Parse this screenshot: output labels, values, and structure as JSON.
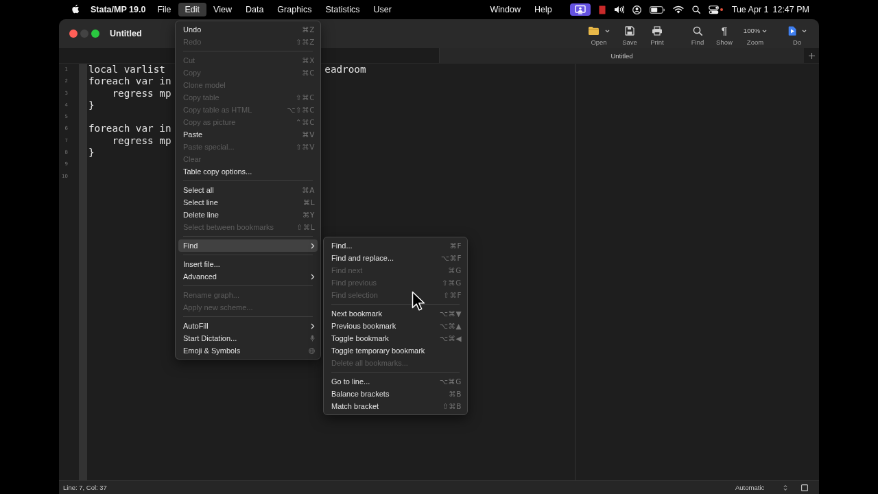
{
  "menu_bar": {
    "app_name": "Stata/MP 19.0",
    "menus": [
      {
        "label": "File",
        "selected": false
      },
      {
        "label": "Edit",
        "selected": true
      },
      {
        "label": "View",
        "selected": false
      },
      {
        "label": "Data",
        "selected": false
      },
      {
        "label": "Graphics",
        "selected": false
      },
      {
        "label": "Statistics",
        "selected": false
      },
      {
        "label": "User",
        "selected": false
      }
    ],
    "right_menus": [
      {
        "label": "Window",
        "selected": false
      },
      {
        "label": "Help",
        "selected": false
      }
    ],
    "date": "Tue Apr 1",
    "time": "12:47 PM"
  },
  "window": {
    "title": "Untitled"
  },
  "toolbar": {
    "tools": [
      {
        "kind": "open",
        "label": "Open",
        "dropdown": true
      },
      {
        "kind": "save",
        "label": "Save",
        "dropdown": false
      },
      {
        "kind": "print",
        "label": "Print",
        "dropdown": false
      },
      {
        "kind": "find",
        "label": "Find",
        "dropdown": false
      },
      {
        "kind": "show",
        "label": "Show",
        "glyph": "¶",
        "dropdown": false
      },
      {
        "kind": "zoom",
        "label": "Zoom",
        "value": "100%",
        "dropdown": true
      },
      {
        "kind": "do",
        "label": "Do",
        "dropdown": true
      }
    ]
  },
  "tabs": [
    {
      "label": "Untitled",
      "selected": true
    }
  ],
  "editor": {
    "lines": [
      {
        "number": "1",
        "parts": [
          "local varlist",
          "eadroom"
        ]
      },
      {
        "number": "2",
        "parts": [
          "foreach var in"
        ]
      },
      {
        "number": "3",
        "parts": [
          "    regress mp"
        ]
      },
      {
        "number": "4",
        "parts": [
          "}"
        ]
      },
      {
        "number": "5"
      },
      {
        "number": "6",
        "parts": [
          "foreach var in"
        ]
      },
      {
        "number": "7",
        "parts": [
          "    regress mp"
        ]
      },
      {
        "number": "8",
        "parts": [
          "}"
        ]
      },
      {
        "number": "9"
      },
      {
        "number": "10"
      }
    ]
  },
  "status_bar": {
    "position": "Line: 7, Col: 37",
    "mode": "Automatic"
  },
  "edit_menu": {
    "sections": [
      [
        {
          "label": "Undo",
          "shortcut": "⌘Z",
          "disabled": false,
          "selected": false,
          "has_submenu": false
        },
        {
          "label": "Redo",
          "shortcut": "⇧⌘Z",
          "disabled": true,
          "selected": false,
          "has_submenu": false
        }
      ],
      [
        {
          "label": "Cut",
          "shortcut": "⌘X",
          "disabled": true,
          "selected": false,
          "has_submenu": false
        },
        {
          "label": "Copy",
          "shortcut": "⌘C",
          "disabled": true,
          "selected": false,
          "has_submenu": false
        },
        {
          "label": "Clone model",
          "disabled": true,
          "selected": false,
          "has_submenu": false
        },
        {
          "label": "Copy table",
          "shortcut": "⇧⌘C",
          "disabled": true,
          "selected": false,
          "has_submenu": false
        },
        {
          "label": "Copy table as HTML",
          "shortcut": "⌥⇧⌘C",
          "disabled": true,
          "selected": false,
          "has_submenu": false
        },
        {
          "label": "Copy as picture",
          "shortcut": "⌃⌘C",
          "disabled": true,
          "selected": false,
          "has_submenu": false
        },
        {
          "label": "Paste",
          "shortcut": "⌘V",
          "disabled": false,
          "selected": false,
          "has_submenu": false
        },
        {
          "label": "Paste special...",
          "shortcut": "⇧⌘V",
          "disabled": true,
          "selected": false,
          "has_submenu": false
        },
        {
          "label": "Clear",
          "disabled": true,
          "selected": false,
          "has_submenu": false
        },
        {
          "label": "Table copy options...",
          "disabled": false,
          "selected": false,
          "has_submenu": false
        }
      ],
      [
        {
          "label": "Select all",
          "shortcut": "⌘A",
          "disabled": false,
          "selected": false,
          "has_submenu": false
        },
        {
          "label": "Select line",
          "shortcut": "⌘L",
          "disabled": false,
          "selected": false,
          "has_submenu": false
        },
        {
          "label": "Delete line",
          "shortcut": "⌘Y",
          "disabled": false,
          "selected": false,
          "has_submenu": false
        },
        {
          "label": "Select between bookmarks",
          "shortcut": "⇧⌘L",
          "disabled": true,
          "selected": false,
          "has_submenu": false
        }
      ],
      [
        {
          "label": "Find",
          "disabled": false,
          "selected": true,
          "has_submenu": true,
          "submenu": {
            "sections": [
              [
                {
                  "label": "Find...",
                  "shortcut": "⌘F",
                  "disabled": false,
                  "selected": false,
                  "has_submenu": false
                },
                {
                  "label": "Find and replace...",
                  "shortcut": "⌥⌘F",
                  "disabled": false,
                  "selected": false,
                  "has_submenu": false
                },
                {
                  "label": "Find next",
                  "shortcut": "⌘G",
                  "disabled": true,
                  "selected": false,
                  "has_submenu": false
                },
                {
                  "label": "Find previous",
                  "shortcut": "⇧⌘G",
                  "disabled": true,
                  "selected": false,
                  "has_submenu": false
                },
                {
                  "label": "Find selection",
                  "shortcut": "⇧⌘F",
                  "disabled": true,
                  "selected": false,
                  "has_submenu": false
                }
              ],
              [
                {
                  "label": "Next bookmark",
                  "shortcut": "⌥⌘▼",
                  "disabled": false,
                  "selected": false,
                  "has_submenu": false
                },
                {
                  "label": "Previous bookmark",
                  "shortcut": "⌥⌘▲",
                  "disabled": false,
                  "selected": false,
                  "has_submenu": false
                },
                {
                  "label": "Toggle bookmark",
                  "shortcut": "⌥⌘◀",
                  "disabled": false,
                  "selected": false,
                  "has_submenu": false
                },
                {
                  "label": "Toggle temporary bookmark",
                  "disabled": false,
                  "selected": false,
                  "has_submenu": false
                },
                {
                  "label": "Delete all bookmarks...",
                  "disabled": true,
                  "selected": false,
                  "has_submenu": false
                }
              ],
              [
                {
                  "label": "Go to line...",
                  "shortcut": "⌥⌘G",
                  "disabled": false,
                  "selected": false,
                  "has_submenu": false
                },
                {
                  "label": "Balance brackets",
                  "shortcut": "⌘B",
                  "disabled": false,
                  "selected": false,
                  "has_submenu": false
                },
                {
                  "label": "Match bracket",
                  "shortcut": "⇧⌘B",
                  "disabled": false,
                  "selected": false,
                  "has_submenu": false
                }
              ]
            ]
          }
        }
      ],
      [
        {
          "label": "Insert file...",
          "disabled": false,
          "selected": false,
          "has_submenu": false
        },
        {
          "label": "Advanced",
          "disabled": false,
          "selected": false,
          "has_submenu": true
        }
      ],
      [
        {
          "label": "Rename graph...",
          "disabled": true,
          "selected": false,
          "has_submenu": false
        },
        {
          "label": "Apply new scheme...",
          "disabled": true,
          "selected": false,
          "has_submenu": false
        }
      ],
      [
        {
          "kind": "plain",
          "label": "AutoFill",
          "disabled": false,
          "selected": false,
          "has_submenu": true
        },
        {
          "kind": "mic",
          "label": "Start Dictation...",
          "disabled": false,
          "selected": false,
          "has_submenu": false
        },
        {
          "kind": "globe",
          "label": "Emoji & Symbols",
          "disabled": false,
          "selected": false,
          "has_submenu": false
        }
      ]
    ]
  }
}
